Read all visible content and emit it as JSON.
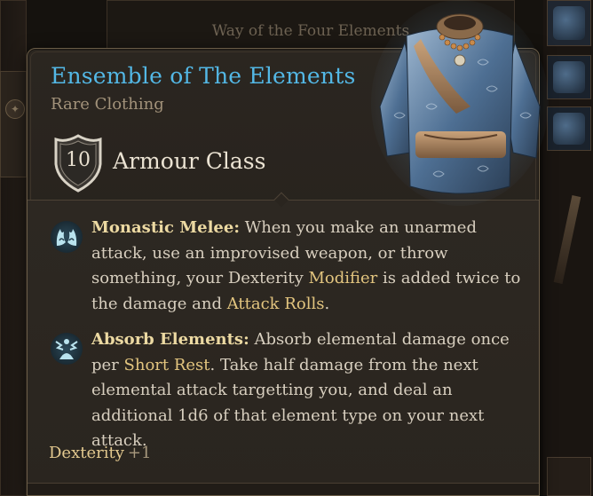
{
  "background": {
    "panel_title": "Way of the Four Elements"
  },
  "item": {
    "name": "Ensemble of The Elements",
    "rarity": "Rare Clothing",
    "armour_class": {
      "value": "10",
      "label": "Armour Class"
    },
    "features": [
      {
        "icon": "monk-flame-fists-icon",
        "title": "Monastic Melee:",
        "text_1": " When you make an unarmed attack, use an improvised weapon, or throw something, your Dexterity ",
        "kw_1": "Modifier",
        "text_2": " is added twice to the damage and ",
        "kw_2": "Attack Rolls",
        "text_3": "."
      },
      {
        "icon": "absorb-elements-icon",
        "title": "Absorb Elements:",
        "text_1": " Absorb elemental damage once per ",
        "kw_1": "Short Rest",
        "text_2": ". Take half damage from the next elemental attack targetting you, and deal an additional 1d6 of that element type on your next attack."
      }
    ],
    "stat": {
      "name": "Dexterity",
      "value": "+1"
    }
  },
  "colors": {
    "name": "#53b8e6",
    "keyword": "#e3c57f",
    "feature_title": "#ecd9a2",
    "body_text": "#d8cfbf",
    "panel_bg": "#2b2620"
  }
}
